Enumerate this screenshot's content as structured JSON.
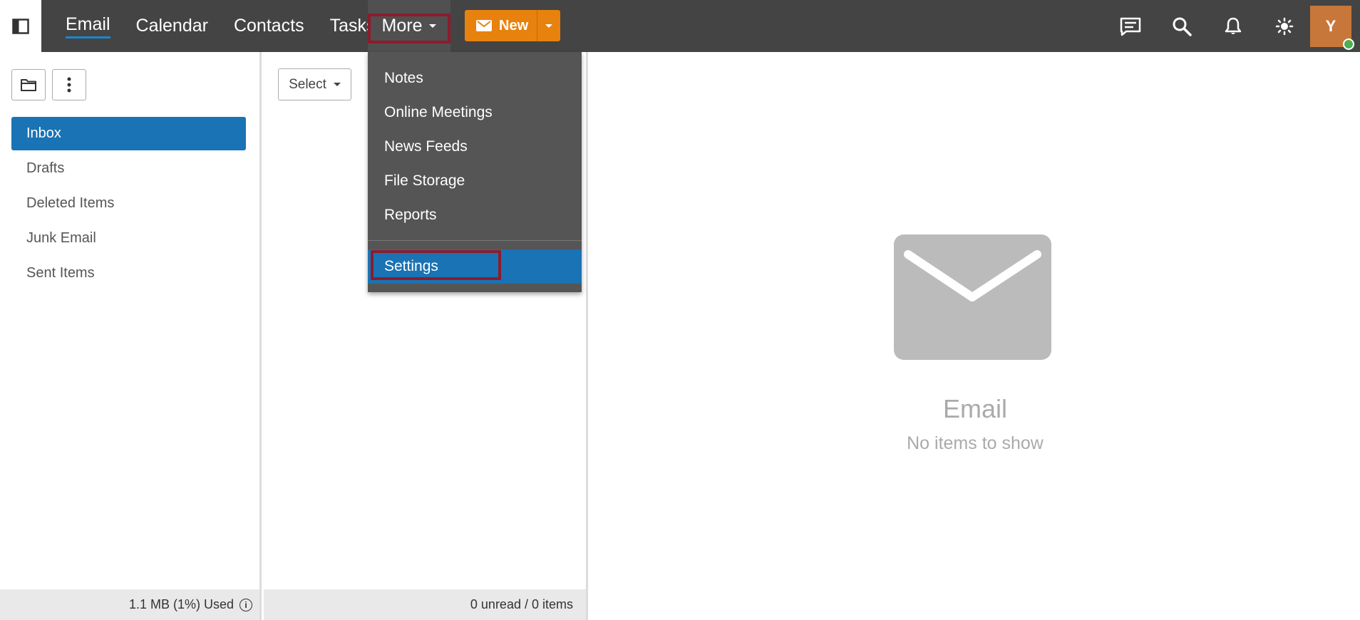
{
  "nav": {
    "items": [
      {
        "label": "Email",
        "active": true
      },
      {
        "label": "Calendar"
      },
      {
        "label": "Contacts"
      },
      {
        "label": "Tasks"
      }
    ],
    "more_label": "More",
    "new_label": "New"
  },
  "user": {
    "initial": "Y",
    "presence": "online"
  },
  "icons": {
    "sidebar_toggle": "sidebar-toggle-icon",
    "chat": "chat-icon",
    "search": "search-icon",
    "bell": "bell-icon",
    "theme": "sun-icon",
    "folder": "folder-icon",
    "more_vertical": "kebab-icon",
    "mail": "mail-icon"
  },
  "folders": [
    {
      "label": "Inbox",
      "active": true
    },
    {
      "label": "Drafts"
    },
    {
      "label": "Deleted Items"
    },
    {
      "label": "Junk Email"
    },
    {
      "label": "Sent Items"
    }
  ],
  "storage": {
    "used": "1.1 MB (1%) Used"
  },
  "list": {
    "select_label": "Select",
    "summary": "0 unread / 0 items"
  },
  "more_menu": {
    "items": [
      "Notes",
      "Online Meetings",
      "News Feeds",
      "File Storage",
      "Reports"
    ],
    "settings": "Settings"
  },
  "reading": {
    "title": "Email",
    "subtitle": "No items to show"
  },
  "colors": {
    "accent": "#1a73b4",
    "new_button": "#e8820e",
    "topbar": "#444444",
    "highlight_box": "#8c1c2c"
  }
}
